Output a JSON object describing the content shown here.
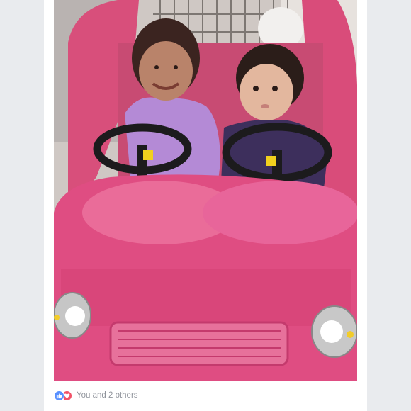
{
  "reactions": {
    "icons": [
      "like-icon",
      "love-icon"
    ],
    "colors": {
      "like": "#5890ff",
      "love": "#f25268"
    },
    "summary": "You and 2 others"
  }
}
